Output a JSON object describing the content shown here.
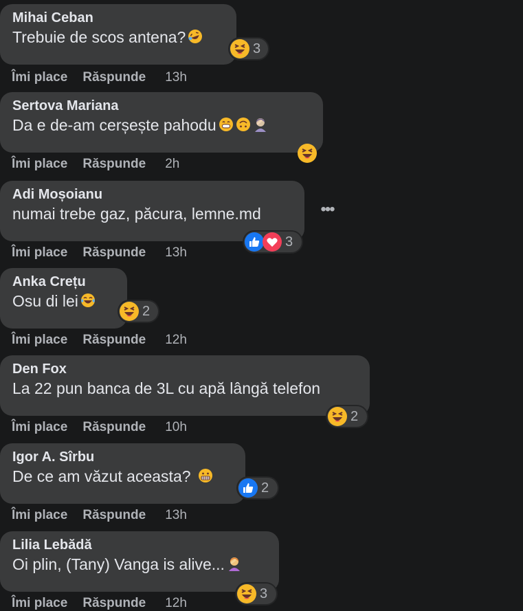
{
  "actions": {
    "like": "Îmi place",
    "reply": "Răspunde"
  },
  "comments": [
    {
      "author": "Mihai Ceban",
      "text": "Trebuie de scos antena?",
      "time": "13h",
      "reaction_count": "3"
    },
    {
      "author": "Sertova Mariana",
      "text": "Da e de-am cerșește pahodu",
      "time": "2h"
    },
    {
      "author": "Adi Moșoianu",
      "text": "numai trebe gaz, păcura, lemne.md",
      "time": "13h",
      "reaction_count": "3"
    },
    {
      "author": "Anka Crețu",
      "text": "Osu di lei",
      "time": "12h",
      "reaction_count": "2"
    },
    {
      "author": "Den Fox",
      "text": "La 22 pun banca de 3L cu apă lângă telefon",
      "time": "10h",
      "reaction_count": "2"
    },
    {
      "author": "Igor A. Sîrbu",
      "text": "De ce am văzut aceasta?",
      "time": "13h",
      "reaction_count": "2"
    },
    {
      "author": "Lilia Lebădă",
      "text": "Oi plin, (Tany) Vanga is alive...",
      "time": "12h",
      "reaction_count": "3"
    }
  ],
  "colors": {
    "background": "#18191a",
    "bubble": "#3a3b3c",
    "text": "#e4e6eb",
    "secondary": "#b0b3b8",
    "like_blue": "#1877f2",
    "love_red": "#f33e58",
    "emoji_yellow": "#f7b928"
  },
  "icons": [
    "rofl-emoji-icon",
    "haha-reaction-icon",
    "grin-emoji-icon",
    "upside-down-emoji-icon",
    "facepalm-emoji-icon",
    "like-reaction-icon",
    "love-reaction-icon",
    "tears-of-joy-emoji-icon",
    "grimace-emoji-icon",
    "more-options-icon"
  ]
}
